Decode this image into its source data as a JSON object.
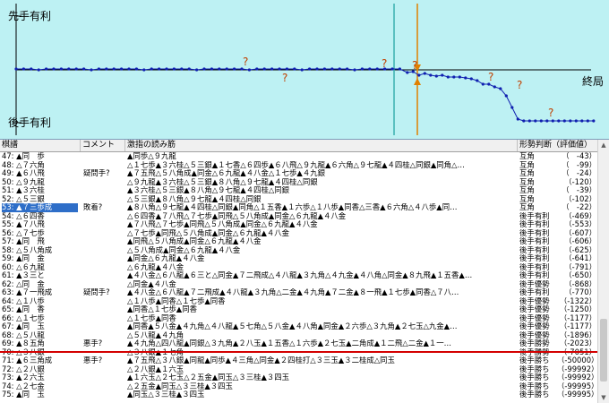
{
  "graph": {
    "label_top": "先手有利",
    "label_bottom": "後手有利",
    "label_end": "終局",
    "question_mark": "?",
    "line_color": "#1020b0",
    "cursor_color": "#e08000",
    "marker_color": "#3ab0b0"
  },
  "list": {
    "headers": {
      "move": "棋譜",
      "comment": "コメント",
      "line": "激指の読み筋",
      "judge": "形勢判断（評価値）"
    },
    "rows": [
      {
        "move": "47: ▲同　歩",
        "comment": "",
        "line": "▲同歩△９九龍",
        "judge": "互角",
        "value": "（　-43）"
      },
      {
        "move": "48: △７六角",
        "comment": "",
        "line": "△１七歩▲３六桂△５三銀▲１七香△６四歩▲６八飛△９九龍▲６六角△９七龍▲４四桂△同銀▲同角△…",
        "judge": "互角",
        "value": "（　-99）"
      },
      {
        "move": "49: ▲６八飛",
        "comment": "疑問手?",
        "line": "▲７五飛△５八角成▲同金△６九龍▲４八金△１七歩▲４九銀",
        "judge": "互角",
        "value": "（　-24）"
      },
      {
        "move": "50: △９九龍",
        "comment": "",
        "line": "△９九龍▲３六桂△５三銀▲８八角△９七龍▲４四桂△同銀",
        "judge": "互角",
        "value": "（-120）"
      },
      {
        "move": "51: ▲３六桂",
        "comment": "",
        "line": "▲３六桂△５三銀▲８八角△９七龍▲４四桂△同銀",
        "judge": "互角",
        "value": "（　-39）"
      },
      {
        "move": "52: △５三銀",
        "comment": "",
        "line": "△５三銀▲８八角△９七龍▲４四桂△同銀",
        "judge": "互角",
        "value": "（-102）"
      },
      {
        "move": "53: ▲７三歩成",
        "comment": "敗着?",
        "line": "▲８八角△９七龍▲４四桂△同銀▲同角△１五香▲１六歩△１八歩▲同香△三香▲６六角△４八歩▲同…",
        "judge": "互角",
        "value": "（　-22）",
        "selected": true
      },
      {
        "move": "54: △６四香",
        "comment": "",
        "line": "△６四香▲７八飛△７七歩▲同飛△５八角成▲同金△６九龍▲４八金",
        "judge": "後手有利",
        "value": "（-469）"
      },
      {
        "move": "55: ▲７八飛",
        "comment": "",
        "line": "▲７八飛△７七歩▲同飛△５八角成▲同金△６九龍▲４八金",
        "judge": "後手有利",
        "value": "（-553）"
      },
      {
        "move": "56: △７七歩",
        "comment": "",
        "line": "△７七歩▲同飛△５八角成▲同金△６九龍▲４八金",
        "judge": "後手有利",
        "value": "（-607）"
      },
      {
        "move": "57: ▲同　飛",
        "comment": "",
        "line": "▲同飛△５八角成▲同金△６九龍▲４八金",
        "judge": "後手有利",
        "value": "（-606）"
      },
      {
        "move": "58: △５八角成",
        "comment": "",
        "line": "△５八角成▲同金△６九龍▲４八金",
        "judge": "後手有利",
        "value": "（-625）"
      },
      {
        "move": "59: ▲同　金",
        "comment": "",
        "line": "▲同金△６九龍▲４八金",
        "judge": "後手有利",
        "value": "（-641）"
      },
      {
        "move": "60: △６九龍",
        "comment": "",
        "line": "△６九龍▲４八金",
        "judge": "後手有利",
        "value": "（-791）"
      },
      {
        "move": "61: ▲３三と",
        "comment": "",
        "line": "▲４八金△６八龍▲６三と△同金▲７二飛成△４八龍▲３九角△４九金▲４八角△同金▲８九飛▲１五香▲…",
        "judge": "後手有利",
        "value": "（-650）"
      },
      {
        "move": "62: △同　金",
        "comment": "",
        "line": "△同金▲４八金",
        "judge": "後手優勢",
        "value": "（-868）"
      },
      {
        "move": "63: ▲７一飛成",
        "comment": "疑問手?",
        "line": "▲４八金△６八龍▲７二飛成▲４八龍▲３九角△二金▲４九角▲７二金▲８一飛▲１七歩▲同香△７八…",
        "judge": "後手有利",
        "value": "（-770）"
      },
      {
        "move": "64: △１八歩",
        "comment": "",
        "line": "△１八歩▲同香△１七歩▲同香",
        "judge": "後手優勢",
        "value": "（-1322）"
      },
      {
        "move": "65: ▲同　香",
        "comment": "",
        "line": "▲同香△１七歩▲同香",
        "judge": "後手優勢",
        "value": "（-1250）"
      },
      {
        "move": "66: △１七歩",
        "comment": "",
        "line": "△１七歩▲同香",
        "judge": "後手優勢",
        "value": "（-1177）"
      },
      {
        "move": "67: ▲同　玉",
        "comment": "",
        "line": "▲同香▲５八金▲４九角△４八龍▲５七角△５八金▲４八角▲同金▲２六歩△３九角▲２七玉△九金▲…",
        "judge": "後手優勢",
        "value": "（-1177）"
      },
      {
        "move": "68: △５八龍",
        "comment": "",
        "line": "△５八龍▲４九角",
        "judge": "後手優勢",
        "value": "（-1896）"
      },
      {
        "move": "69: ▲８五角",
        "comment": "悪手?",
        "line": "▲４九角△四八龍▲同銀△３九角▲２八玉▲１五香△１六歩▲２七玉▲二角成▲１二飛△二金▲１一…",
        "judge": "後手勝勢",
        "value": "（-2023）"
      },
      {
        "move": "70: △３八銀",
        "comment": "",
        "line": "△３八銀▲１七角",
        "judge": "後手勝勢",
        "value": "（-7051）"
      },
      {
        "move": "71: ▲６三角成",
        "comment": "悪手?",
        "line": "▲７五飛△３八銀▲同龍▲同歩▲４三角△同金▲２四桂打△３三玉▲３二桂成△同玉",
        "judge": "後手勝ち",
        "value": "（-50000）"
      },
      {
        "move": "72: △２八銀",
        "comment": "",
        "line": "△２八銀▲１六玉",
        "judge": "後手勝ち",
        "value": "（-99992）"
      },
      {
        "move": "73: ▲２六玉",
        "comment": "",
        "line": "▲１六玉△２七玉△２五金▲同玉△３三桂▲３四玉",
        "judge": "後手勝ち",
        "value": "（-99992）"
      },
      {
        "move": "74: △２七金",
        "comment": "",
        "line": "△２五金▲同玉△３三桂▲３四玉",
        "judge": "後手勝ち",
        "value": "（-99995）"
      },
      {
        "move": "75: ▲同　玉",
        "comment": "",
        "line": "▲同玉△３三桂▲３四玉",
        "judge": "後手勝ち",
        "value": "（-99995）"
      }
    ]
  }
}
